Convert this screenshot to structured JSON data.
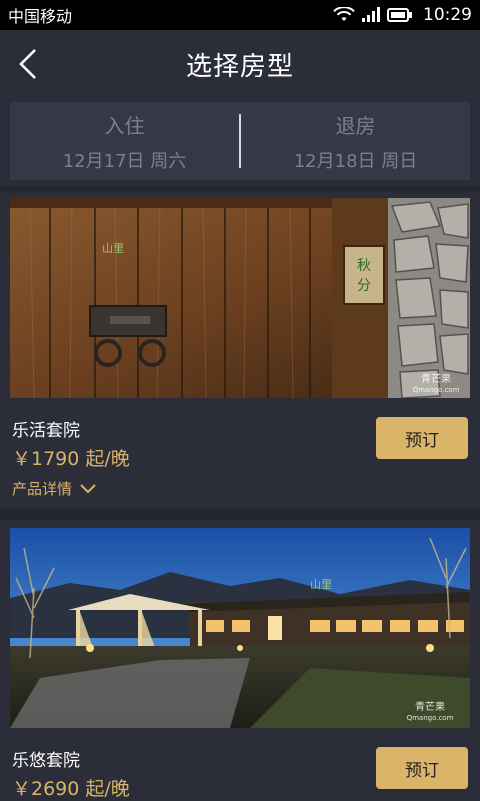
{
  "status": {
    "carrier": "中国移动",
    "time": "10:29"
  },
  "header": {
    "title": "选择房型"
  },
  "dates": {
    "checkin_label": "入住",
    "checkin_value": "12月17日 周六",
    "checkout_label": "退房",
    "checkout_value": "12月18日 周日"
  },
  "rooms": [
    {
      "name": "乐活套院",
      "price": "￥1790 起/晚",
      "details": "产品详情",
      "book": "预订",
      "watermark": "山里",
      "sign": "秋分",
      "brand": "青芒果",
      "brand_url": "Qmango.com"
    },
    {
      "name": "乐悠套院",
      "price": "￥2690 起/晚",
      "book": "预订",
      "watermark": "山里",
      "brand": "青芒果",
      "brand_url": "Qmango.com"
    }
  ],
  "colors": {
    "accent": "#d9b469",
    "background": "#2b2d38",
    "panel": "#353848"
  }
}
